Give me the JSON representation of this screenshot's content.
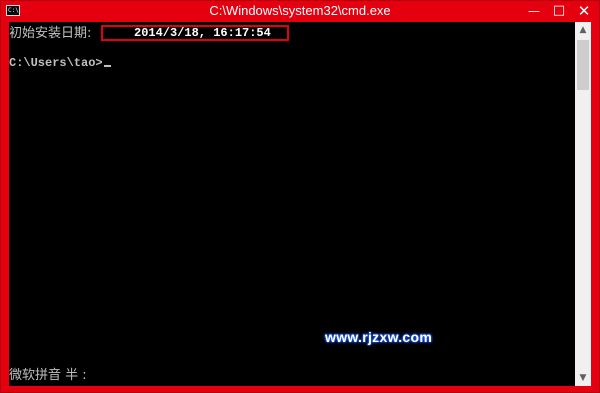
{
  "window": {
    "title": "C:\\Windows\\system32\\cmd.exe",
    "icon_label": "C:\\",
    "min_glyph": "—",
    "max_glyph": "□",
    "close_glyph": "✕",
    "accent_color": "#e4000f"
  },
  "console": {
    "install_date_label": "初始安装日期:",
    "install_date_value": "2014/3/18, 16:17:54",
    "prompt": "C:\\Users\\tao>",
    "ime_status": "微软拼音 半 :",
    "watermark": "www.rjzxw.com"
  },
  "scrollbar": {
    "up_glyph": "▲",
    "down_glyph": "▼"
  }
}
